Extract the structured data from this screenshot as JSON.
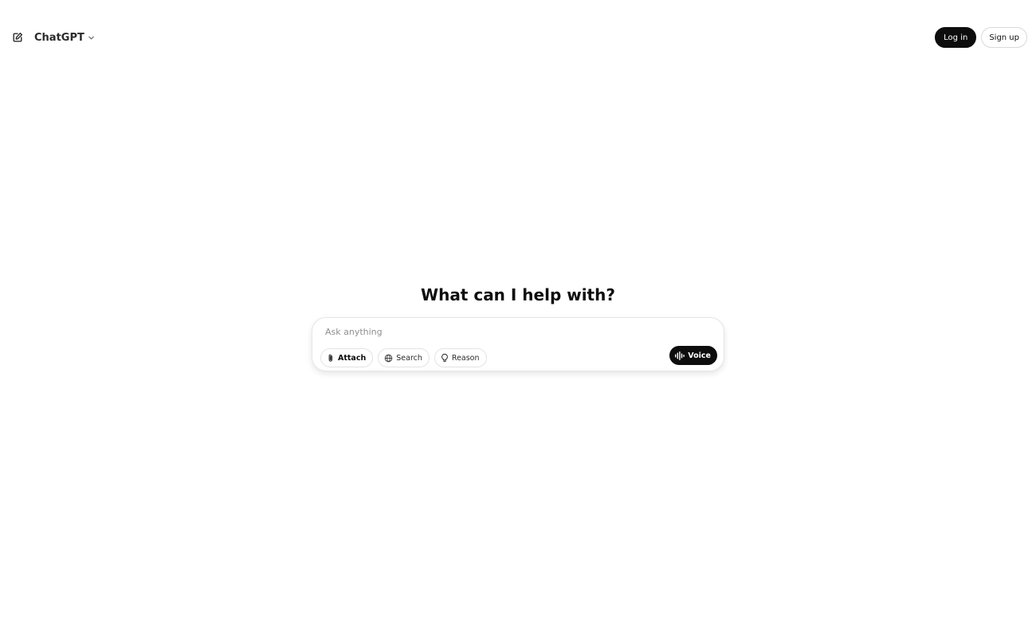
{
  "header": {
    "model_name": "ChatGPT",
    "new_chat_icon": "edit-icon",
    "model_chevron_icon": "chevron-down-icon",
    "login_label": "Log in",
    "signup_label": "Sign up"
  },
  "main": {
    "headline": "What can I help with?"
  },
  "composer": {
    "placeholder": "Ask anything",
    "tools": [
      {
        "label": "Attach",
        "icon": "paperclip-icon"
      },
      {
        "label": "Search",
        "icon": "globe-icon"
      },
      {
        "label": "Reason",
        "icon": "lightbulb-icon"
      }
    ],
    "voice_label": "Voice",
    "voice_icon": "waveform-icon"
  },
  "colors": {
    "primary": "#0d0d0d",
    "background": "#ffffff",
    "border": "#e3e3e3",
    "placeholder": "#8f8f8f"
  }
}
